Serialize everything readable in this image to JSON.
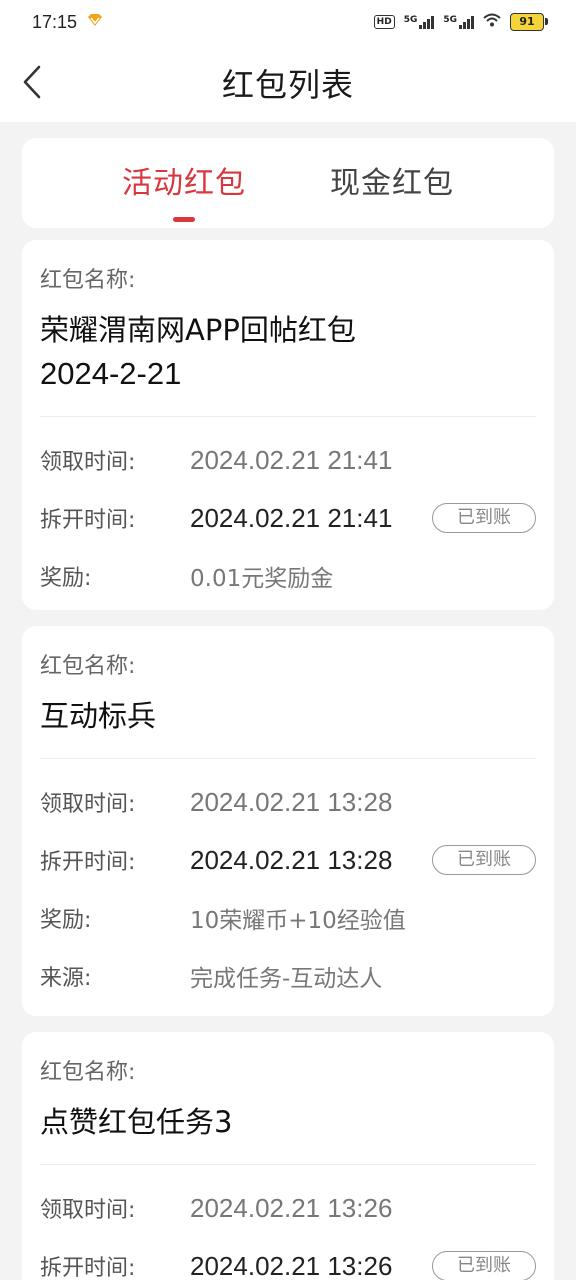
{
  "status_bar": {
    "time": "17:15",
    "hd": "HD",
    "net1": "5G",
    "net2": "5G",
    "battery": "91"
  },
  "header": {
    "title": "红包列表"
  },
  "tabs": [
    {
      "label": "活动红包",
      "active": true
    },
    {
      "label": "现金红包",
      "active": false
    }
  ],
  "labels": {
    "name": "红包名称:",
    "receive_time": "领取时间:",
    "open_time": "拆开时间:",
    "reward": "奖励:",
    "source": "来源:"
  },
  "cards": [
    {
      "name_line1": "荣耀渭南网APP回帖红包",
      "name_line2": "2024-2-21",
      "receive_time": "2024.02.21 21:41",
      "open_time": "2024.02.21 21:41",
      "status": "已到账",
      "reward": "0.01元奖励金"
    },
    {
      "name_line1": "互动标兵",
      "receive_time": "2024.02.21 13:28",
      "open_time": "2024.02.21 13:28",
      "status": "已到账",
      "reward": "10荣耀币+10经验值",
      "source": "完成任务-互动达人"
    },
    {
      "name_line1": "点赞红包任务3",
      "receive_time": "2024.02.21 13:26",
      "open_time": "2024.02.21 13:26",
      "status": "已到账"
    }
  ]
}
